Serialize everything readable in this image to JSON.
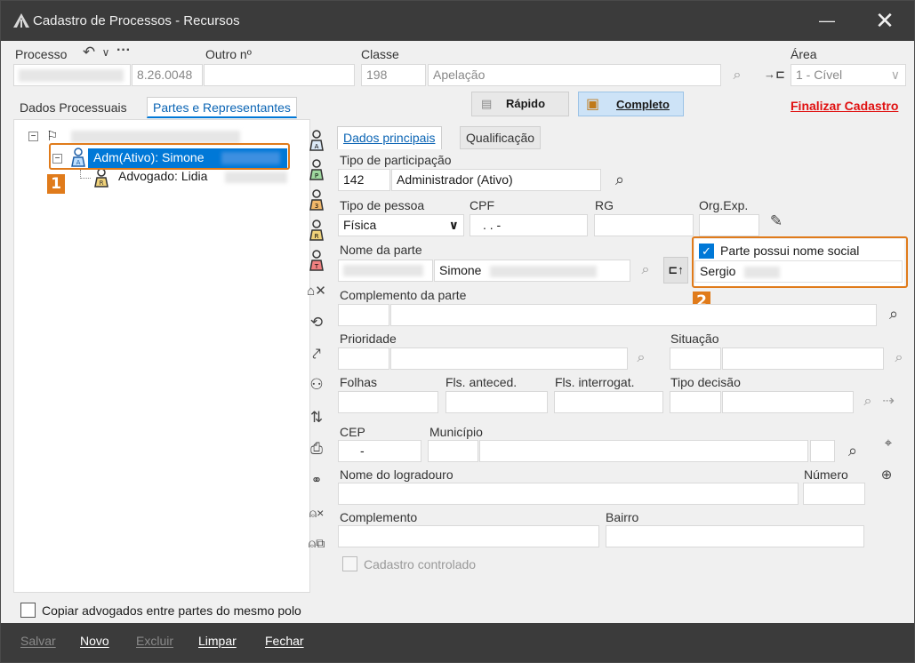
{
  "window": {
    "title": "Cadastro de Processos - Recursos",
    "minimize_glyph": "—",
    "close_glyph": "✕"
  },
  "header": {
    "processo_label": "Processo",
    "processo_number": "8.26.0048",
    "outro_label": "Outro nº",
    "classe_label": "Classe",
    "classe_code": "198",
    "classe_name": "Apelação",
    "area_label": "Área",
    "area_value": "1 - Cível"
  },
  "tabs": {
    "dados": "Dados Processuais",
    "partes": "Partes e Representantes"
  },
  "view_toggle": {
    "rapido": "Rápido",
    "completo": "Completo"
  },
  "finalizar": "Finalizar Cadastro",
  "tree": {
    "adm": "Adm(Ativo): Simone",
    "advogado": "Advogado: Lidia"
  },
  "subtabs": {
    "dados_principais": "Dados principais",
    "qualificacao": "Qualificação"
  },
  "form": {
    "tipo_participacao_label": "Tipo de participação",
    "tipo_participacao_code": "142",
    "tipo_participacao_name": "Administrador (Ativo)",
    "tipo_pessoa_label": "Tipo de pessoa",
    "tipo_pessoa_value": "Física",
    "cpf_label": "CPF",
    "cpf_value": ". . -",
    "rg_label": "RG",
    "orgexp_label": "Org.Exp.",
    "nome_parte_label": "Nome da parte",
    "nome_parte_value": "Simone",
    "nome_social_check": "Parte possui nome social",
    "nome_social_value": "Sergio",
    "complemento_parte_label": "Complemento da parte",
    "prioridade_label": "Prioridade",
    "situacao_label": "Situação",
    "folhas_label": "Folhas",
    "fls_anteced_label": "Fls. anteced.",
    "fls_interrog_label": "Fls. interrogat.",
    "tipo_decisao_label": "Tipo decisão",
    "cep_label": "CEP",
    "cep_value": "-",
    "municipio_label": "Município",
    "logradouro_label": "Nome do logradouro",
    "numero_label": "Número",
    "complemento_label": "Complemento",
    "bairro_label": "Bairro",
    "cadastro_controlado": "Cadastro controlado"
  },
  "copiar_advogados": "Copiar advogados entre partes do mesmo polo",
  "callouts": {
    "one": "1",
    "two": "2"
  },
  "bottom": {
    "salvar": "Salvar",
    "novo": "Novo",
    "excluir": "Excluir",
    "limpar": "Limpar",
    "fechar": "Fechar"
  },
  "colors": {
    "accent": "#0078d7",
    "callout": "#e07b1b",
    "finalizar": "#e01010",
    "titlebar": "#3b3b3b"
  }
}
